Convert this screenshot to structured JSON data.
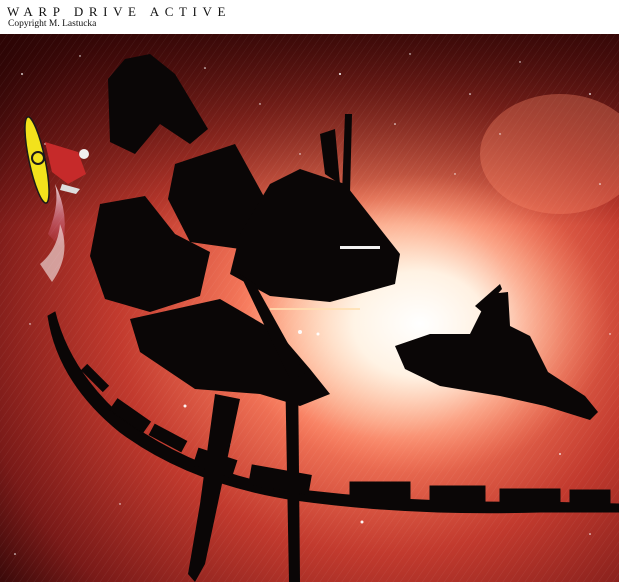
{
  "header": {
    "title": "WARP DRIVE ACTIVE",
    "copyright": "Copyright M. Lastucka"
  },
  "artwork": {
    "subject": [
      "snowboarder-figure",
      "space-station-silhouette",
      "starship-silhouette",
      "ring-arm-structure",
      "nebula-background",
      "starfield"
    ],
    "colors": {
      "nebula_dark": "#4a0b0b",
      "nebula_mid": "#c2412f",
      "nebula_glow": "#ff9c78",
      "core_white": "#fffaf2",
      "silhouette": "#0a0606",
      "snowboard": "#f2e21c"
    }
  }
}
